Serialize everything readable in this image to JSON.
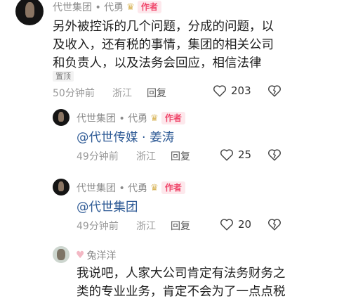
{
  "comment1": {
    "author": "代世集团 • 代勇",
    "crown": "♛",
    "badge": "作者",
    "lines": [
      "另外被控诉的几个问题，分成的问题，以",
      "及收入，还有税的事情，集团的相关公司",
      "和负责人，以及法务会回应，相信法律"
    ],
    "pinned": "置顶",
    "time": "50分钟前",
    "location": "浙江",
    "reply": "回复",
    "likes": "203"
  },
  "comment2": {
    "author": "代世集团 • 代勇",
    "crown": "♛",
    "badge": "作者",
    "mention": "@代世传媒 · 姜涛",
    "time": "49分钟前",
    "location": "浙江",
    "reply": "回复",
    "likes": "25"
  },
  "comment3": {
    "author": "代世集团 • 代勇",
    "crown": "♛",
    "badge": "作者",
    "mention": "@代世集团",
    "time": "49分钟前",
    "location": "浙江",
    "reply": "回复",
    "likes": "20"
  },
  "comment4": {
    "heart": "♥",
    "author": "兔洋洋",
    "lines": [
      "我说吧，人家大公司肯定有法务财务之",
      "类的专业业务，肯定不会为了一点点税"
    ]
  }
}
